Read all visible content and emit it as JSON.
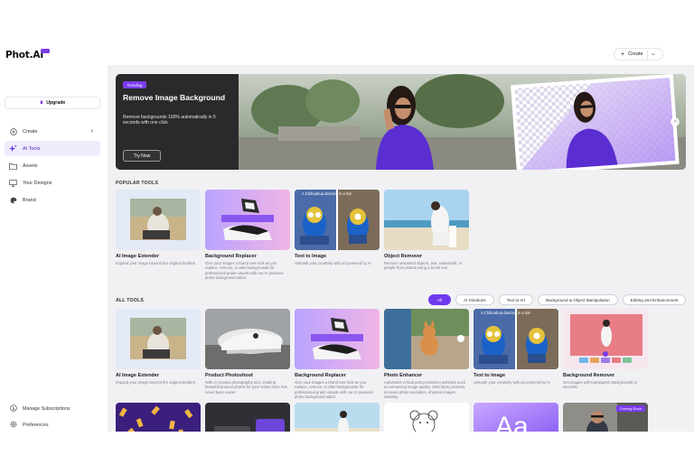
{
  "brand": {
    "name": "Phot.AI"
  },
  "header": {
    "create_label": "Create"
  },
  "sidebar": {
    "upgrade_label": "Upgrade",
    "items": [
      {
        "label": "Create",
        "icon": "plus-circle-icon"
      },
      {
        "label": "AI Tools",
        "icon": "sparkle-icon"
      },
      {
        "label": "Assets",
        "icon": "folder-icon"
      },
      {
        "label": "Your Designs",
        "icon": "monitor-icon"
      },
      {
        "label": "Brand",
        "icon": "palette-icon"
      }
    ],
    "bottom": [
      {
        "label": "Manage Subscriptions",
        "icon": "dollar-icon"
      },
      {
        "label": "Preferences",
        "icon": "gear-icon"
      }
    ]
  },
  "hero": {
    "badge": "Trending",
    "title": "Remove Image Background",
    "subtitle": "Remove backgrounds 100% automatically in 5 seconds with one click",
    "button": "Try Now"
  },
  "popular": {
    "title": "POPULAR TOOLS",
    "cards": [
      {
        "title": "AI Image Extender",
        "desc": "Expand your image beyond the original borders."
      },
      {
        "title": "Background Replacer",
        "desc": "Give your images a brand new look as you replace, remove, or alter backgrounds for professional-grade visuals with our AI powered photo background editor"
      },
      {
        "title": "Text to Image",
        "desc": "Unleash your creativity with art powered by AI",
        "overlay": "A Chihuahua dancing in a hat"
      },
      {
        "title": "Object Remover",
        "desc": "Remove unwanted objects, text, watermark, or people from photos using a brush tool"
      }
    ]
  },
  "all_tools": {
    "title": "ALL TOOLS",
    "filters": [
      "All",
      "AI Solutions",
      "Text to Art",
      "Background & Object Manipulation",
      "Editing and Enhancement"
    ],
    "cards": [
      {
        "title": "AI Image Extender",
        "desc": "Expand your image beyond the original borders."
      },
      {
        "title": "Product Photoshoot",
        "desc": "With AI product photography tool, creating beautiful product photos for your online store has never been easier."
      },
      {
        "title": "Background Replacer",
        "desc": "Give your images a brand new look as you replace, remove, or alter backgrounds for professional-grade visuals with our AI powered photo background editor"
      },
      {
        "title": "Photo Enhancer",
        "desc": "Automates critical post production activities such as enhancing image quality, clear blurry pictures, increase photo resolution, sharpen images instantly."
      },
      {
        "title": "Text to Image",
        "desc": "Unleash your creativity with art powered by AI",
        "overlay": "A Chihuahua dancing in a hat"
      },
      {
        "title": "Background Remover",
        "desc": "Get images with transparent backgrounds in seconds."
      }
    ],
    "coming_soon": "Coming Soon"
  },
  "colors": {
    "accent": "#6f39ee",
    "sidebar_active": "#f0ebfd",
    "main_bg": "#f1f1f4"
  }
}
